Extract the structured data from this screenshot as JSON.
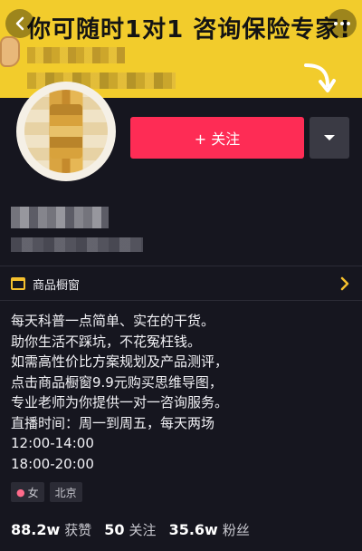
{
  "banner": {
    "headline": "你可随时1对1 咨询保险专家!",
    "background_color": "#f2cc2c"
  },
  "actions": {
    "follow_label": "+ 关注",
    "follow_color": "#fe2c55"
  },
  "shop_window": {
    "label": "商品橱窗"
  },
  "bio": {
    "lines": [
      "每天科普一点简单、实在的干货。",
      "助你生活不踩坑，不花冤枉钱。",
      "如需高性价比方案规划及产品测评，",
      "点击商品橱窗9.9元购买思维导图，",
      "专业老师为你提供一对一咨询服务。",
      "直播时间：周一到周五，每天两场",
      "12:00-14:00",
      "18:00-20:00"
    ]
  },
  "tags": {
    "gender": "女",
    "location": "北京"
  },
  "stats": {
    "likes_value": "88.2w",
    "likes_label": "获赞",
    "following_value": "50",
    "following_label": "关注",
    "followers_value": "35.6w",
    "followers_label": "粉丝"
  },
  "icons": {
    "back": "chevron-left-icon",
    "more": "more-dots-icon",
    "dropdown": "caret-down-icon",
    "shop": "shop-window-icon",
    "gender": "female-icon"
  }
}
